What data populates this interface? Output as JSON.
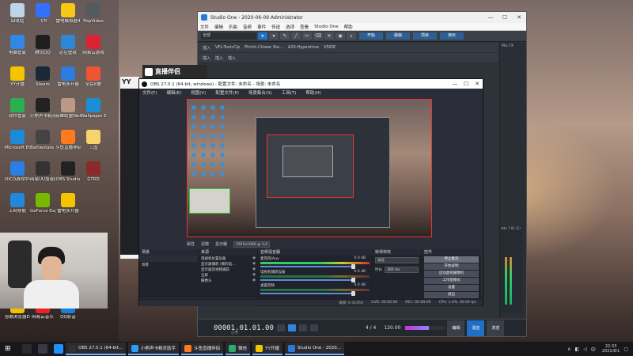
{
  "desktop_icons": [
    {
      "label": "回收站",
      "color": "#bcd3e8"
    },
    {
      "label": "飞书",
      "color": "#3370ff"
    },
    {
      "label": "雷电模拟器4",
      "color": "#f6c915"
    },
    {
      "label": "PopVideo",
      "color": "#555a60"
    },
    {
      "label": "电脑管家",
      "color": "#2f87e6"
    },
    {
      "label": "腾讯QQ",
      "color": "#1e1e1e"
    },
    {
      "label": "必应壁纸",
      "color": "#2b88d8"
    },
    {
      "label": "网易云游戏",
      "color": "#d23"
    },
    {
      "label": "YY开播",
      "color": "#f5c400"
    },
    {
      "label": "Steam",
      "color": "#1b2838"
    },
    {
      "label": "雷电多开器",
      "color": "#2e7be0"
    },
    {
      "label": "全民K歌",
      "color": "#e53"
    },
    {
      "label": "软件管家",
      "color": "#2ab050"
    },
    {
      "label": "小熊声卡精灵",
      "color": "#222"
    },
    {
      "label": "英雄联盟WeGame版",
      "color": "#b98"
    },
    {
      "label": "Wallpaper Engine:...",
      "color": "#1a8fd8"
    },
    {
      "label": "Microsoft Edge",
      "color": "#1a8bd8"
    },
    {
      "label": "Battlestate Games L...",
      "color": "#444"
    },
    {
      "label": "斗鱼直播伴侣",
      "color": "#ff7a1c"
    },
    {
      "label": "三国",
      "color": "#f7d36b"
    },
    {
      "label": "OICQ游戏中心",
      "color": "#2a7fe5"
    },
    {
      "label": "网易UU加速器",
      "color": "#333"
    },
    {
      "label": "OBS Studio",
      "color": "#222"
    },
    {
      "label": "GTRD",
      "color": "#8a2a2a"
    },
    {
      "label": "上网导航",
      "color": "#2288dd"
    },
    {
      "label": "GeForce Experience",
      "color": "#76b900"
    },
    {
      "label": "雷电多开器",
      "color": "#f5c400"
    },
    {
      "label": "谷歌浏览器DEEEER G...",
      "color": "#f2c200"
    },
    {
      "label": "网易云音乐",
      "color": "#e22"
    },
    {
      "label": "QQ影音",
      "color": "#1a7de0"
    }
  ],
  "studio_one": {
    "title": "Studio One - 2020-06-09 Administrator",
    "menu": [
      "文件",
      "编辑",
      "乐曲",
      "音频",
      "事件",
      "传送",
      "选项",
      "查看",
      "Studio One",
      "帮助"
    ],
    "field": "全部",
    "page_tabs": [
      "开始",
      "歌曲",
      "项目",
      "演示"
    ],
    "tracks": [
      "插入",
      "插入",
      "插入",
      "插入"
    ],
    "plugins": [
      "VPL-TonicClp",
      "Pitchh.Chiwar Ste...",
      "A20-Hyperdrive",
      "VSIDE"
    ],
    "right_label": "Mix FX",
    "time": "00001.01.01.00",
    "time_sub": "小节",
    "bpm": "120.00",
    "sig": "4 / 4",
    "bottom_tabs": [
      "编辑",
      "混音",
      "浏览"
    ],
    "mix_label": "Ade 7.01 (1)"
  },
  "zbbl": {
    "text": "直播伴侣"
  },
  "yy": {
    "text": "YY"
  },
  "obs": {
    "title": "OBS 27.0.1 (64-bit, windows) - 配置文件: 未命名 - 场景: 未命名",
    "menu": [
      "文件(F)",
      "编辑(E)",
      "视图(V)",
      "配置文件(P)",
      "场景集合(S)",
      "工具(T)",
      "帮助(H)"
    ],
    "src_bar": [
      "属性",
      "滤镜",
      "显示器",
      "1920x1080 @ 0,0"
    ],
    "docks": {
      "scenes": {
        "title": "场景",
        "items": [
          "场景"
        ]
      },
      "sources": {
        "title": "来源",
        "items": [
          "电视机位置设备",
          "显示器捕获 (我的电...",
          "显示器音视频捕获",
          "全屏",
          "摄像头"
        ]
      },
      "mixer": {
        "title": "音频混音器",
        "rows": [
          {
            "name": "麦克风/Aux",
            "db": "0.0 dB"
          },
          {
            "name": "电视机捕获设备",
            "db": "0.0 dB"
          },
          {
            "name": "桌面音频",
            "db": "0.0 dB"
          }
        ]
      },
      "transitions": {
        "title": "转场特效",
        "type": "淡化",
        "duration_label": "时长",
        "duration": "300 ms"
      },
      "controls": {
        "title": "控件",
        "buttons": [
          "停止推流",
          "开始录制",
          "启动虚拟摄像机",
          "工作室模式",
          "设置",
          "退出"
        ]
      }
    },
    "status": [
      "丢帧: 0 (0.0%)",
      "LIVE: 00:00:00",
      "REC: 00:00:00",
      "CPU: 1.0%, 60.00 fps"
    ]
  },
  "taskbar": {
    "apps": [
      {
        "label": "OBS 27.0.1 (64-bit...",
        "color": "#333"
      },
      {
        "label": "小熊声卡精灵助手",
        "color": "#2a9df4"
      },
      {
        "label": "斗鱼直播伴侣",
        "color": "#ff7a1c"
      },
      {
        "label": "微信",
        "color": "#2aae67"
      },
      {
        "label": "YY开播",
        "color": "#f5c400"
      },
      {
        "label": "Studio One - 2020...",
        "color": "#2b7bd6"
      }
    ],
    "time": "22:33",
    "date": "2021/8/1"
  }
}
